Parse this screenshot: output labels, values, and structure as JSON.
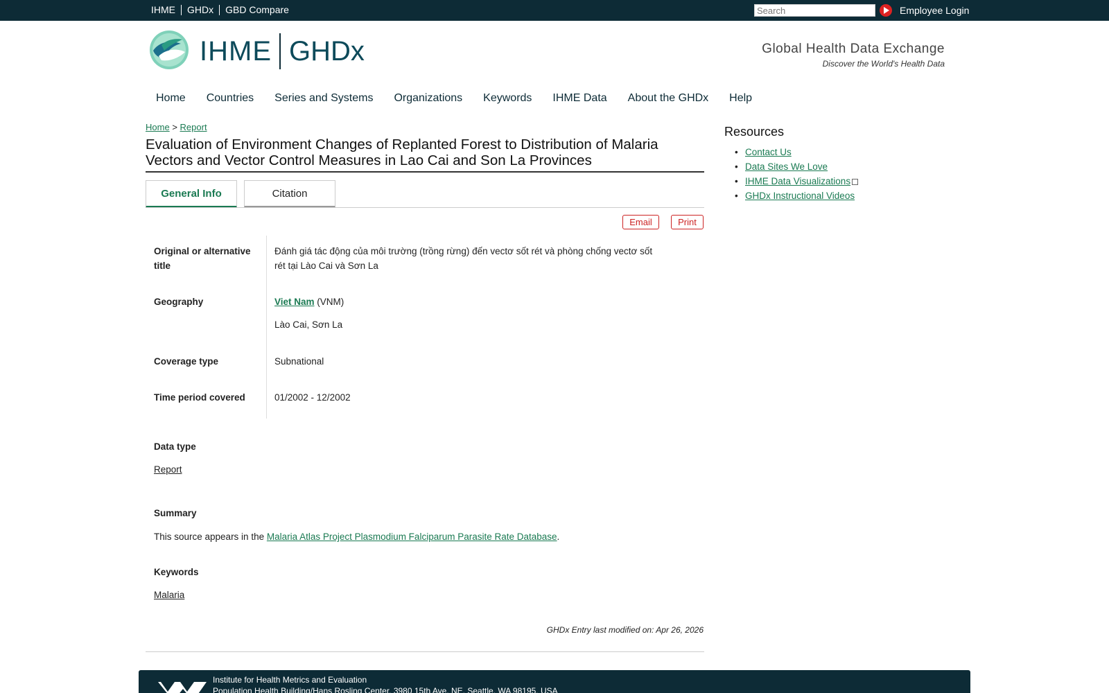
{
  "topbar": {
    "links": [
      "IHME",
      "GHDx",
      "GBD Compare"
    ],
    "search_placeholder": "Search",
    "employee_login": "Employee Login"
  },
  "header": {
    "logo_ihme": "IHME",
    "logo_ghdx": "GHDx",
    "tagline": "Global Health Data Exchange",
    "subtagline": "Discover the World's Health Data"
  },
  "nav": {
    "items": [
      "Home",
      "Countries",
      "Series and Systems",
      "Organizations",
      "Keywords",
      "IHME Data",
      "About the GHDx",
      "Help"
    ]
  },
  "breadcrumb": {
    "home": "Home",
    "separator": ">",
    "current": "Report"
  },
  "page": {
    "title": "Evaluation of Environment Changes of Replanted Forest to Distribution of Malaria Vectors and Vector Control Measures in Lao Cai and Son La Provinces",
    "tabs": [
      "General Info",
      "Citation"
    ],
    "email_button": "Email",
    "print_button": "Print"
  },
  "fields": {
    "original_title_label": "Original or alternative title",
    "original_title_value": "Đánh giá tác động của môi trường (trồng rừng) đến vectơ sốt rét và phòng chống vectơ sốt rét tại Lào Cai và Sơn La",
    "geography_label": "Geography",
    "geography_country": "Viet Nam",
    "geography_code": "(VNM)",
    "geography_subnational": "Lào Cai, Sơn La",
    "coverage_label": "Coverage type",
    "coverage_value": "Subnational",
    "time_label": "Time period covered",
    "time_value": "01/2002 - 12/2002",
    "datatype_label": "Data type",
    "datatype_value": "Report",
    "summary_label": "Summary",
    "summary_prefix": "This source appears in the",
    "summary_link": "Malaria Atlas Project Plasmodium Falciparum Parasite Rate Database",
    "summary_suffix": ".",
    "keywords_label": "Keywords",
    "keywords_value": "Malaria"
  },
  "modified": "GHDx Entry last modified on: Apr 26, 2026",
  "sidebar": {
    "title": "Resources",
    "links": [
      "Contact Us",
      "Data Sites We Love",
      "IHME Data Visualizations",
      "GHDx Instructional Videos"
    ]
  },
  "footer": {
    "line1": "Institute for Health Metrics and Evaluation",
    "line2": "Population Health Building/Hans Rosling Center, 3980 15th Ave. NE, Seattle, WA 98195, USA"
  },
  "colors": {
    "topbar_bg": "#0d2b36",
    "link": "#1a7a52",
    "button_red": "#cc2222"
  }
}
